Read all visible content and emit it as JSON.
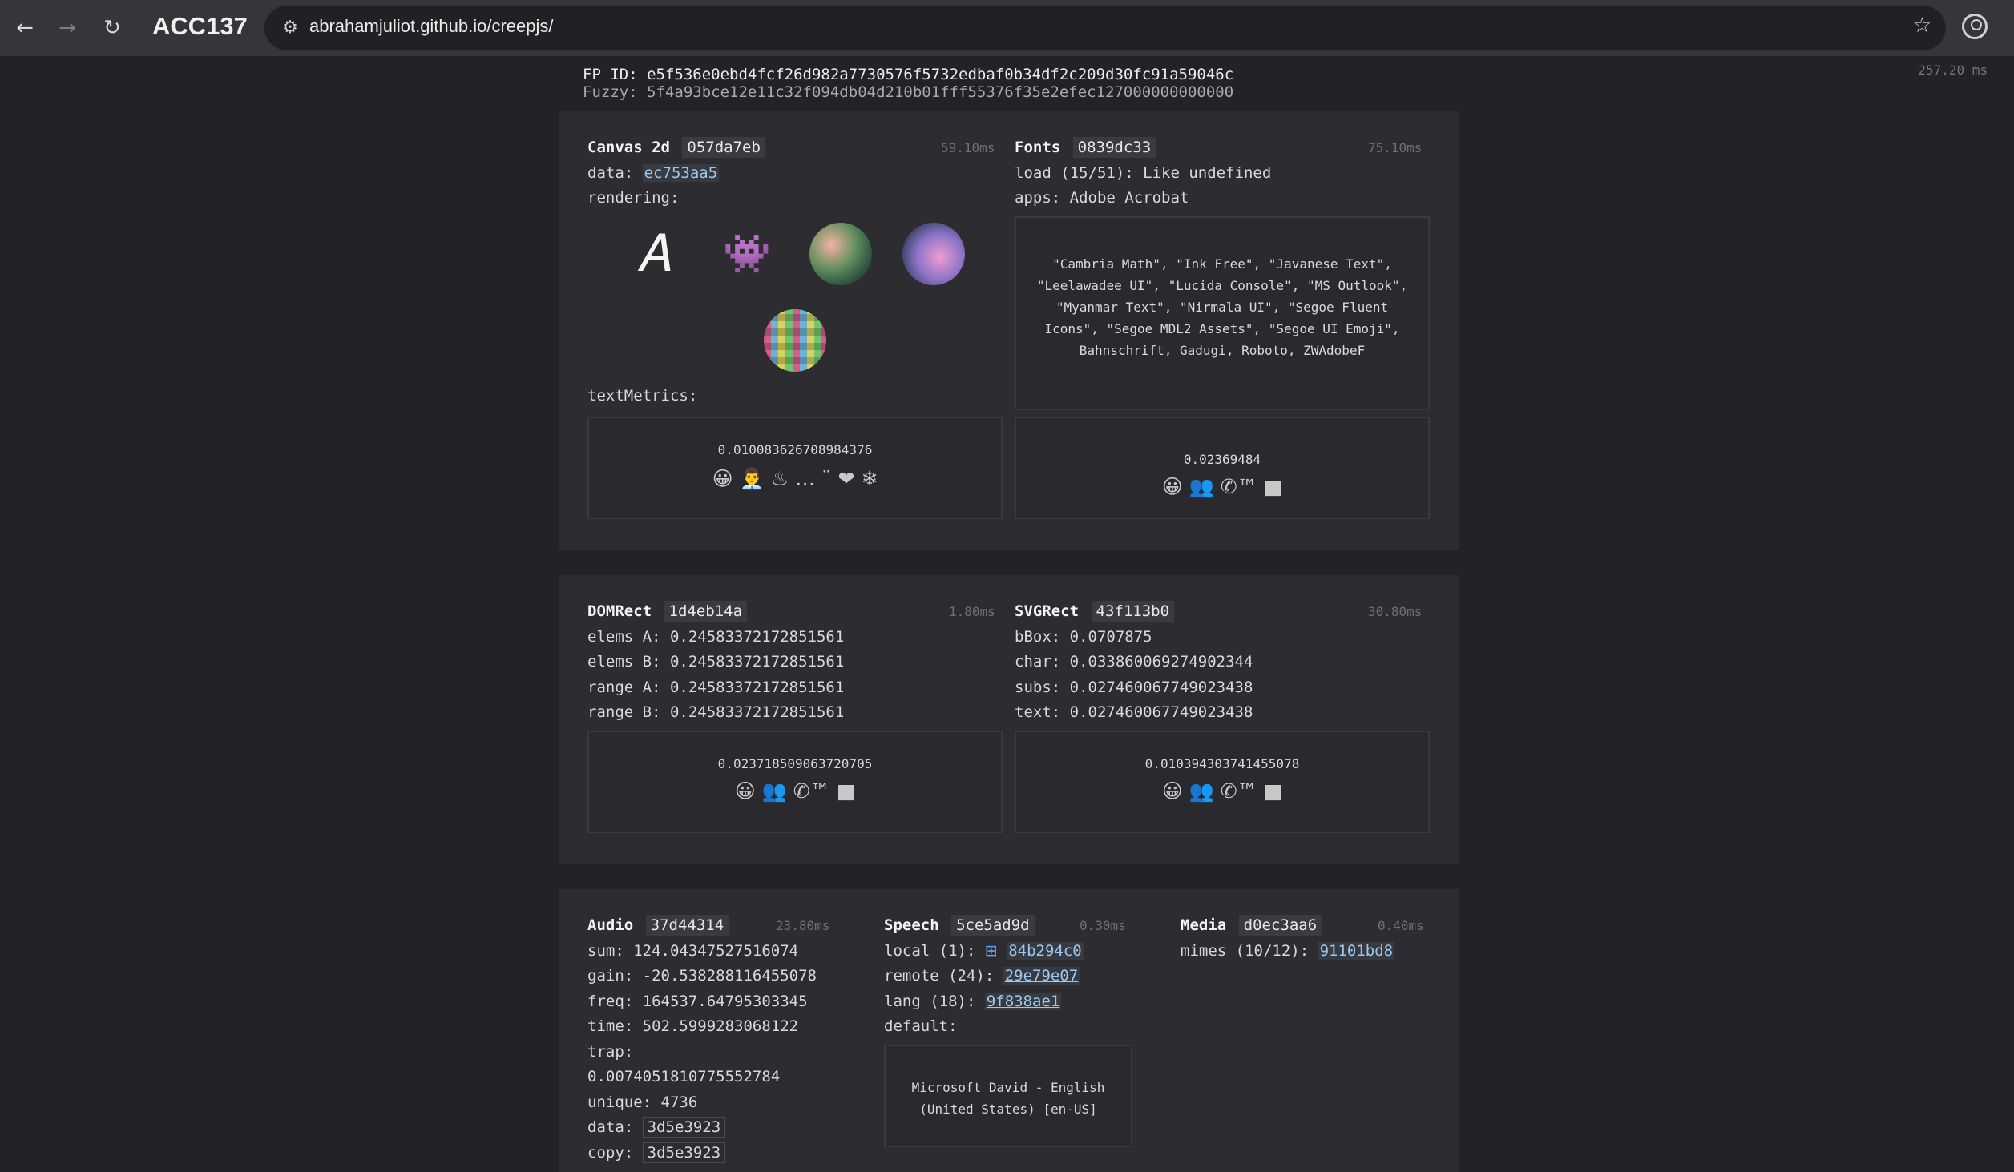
{
  "browser": {
    "tab_title": "ACC137",
    "url": "abrahamjuliot.github.io/creepjs/"
  },
  "header": {
    "fp_id_label": "FP ID:",
    "fp_id": "e5f536e0ebd4fcf26d982a7730576f5732edbaf0b34df2c209d30fc91a59046c",
    "fuzzy_label": "Fuzzy:",
    "fuzzy": "5f4a93bce12e11c32f094db04d210b01fff55376f35e2efec127000000000000",
    "total_time": "257.20 ms"
  },
  "canvas": {
    "title": "Canvas 2d",
    "hash": "057da7eb",
    "time": "59.10ms",
    "data_label": "data:",
    "data_hash": "ec753aa5",
    "rendering_label": "rendering:",
    "text_metrics_label": "textMetrics:",
    "metric_value": "0.010083626708984376",
    "metric_emojis": "😀 👨‍💼 ♨ … ¨ ❤ ❄"
  },
  "fonts": {
    "title": "Fonts",
    "hash": "0839dc33",
    "time": "75.10ms",
    "load": "load (15/51): Like undefined",
    "apps": "apps: Adobe Acrobat",
    "font_list": "\"Cambria Math\", \"Ink Free\", \"Javanese Text\", \"Leelawadee UI\", \"Lucida Console\", \"MS Outlook\", \"Myanmar Text\", \"Nirmala UI\", \"Segoe Fluent Icons\", \"Segoe MDL2 Assets\", \"Segoe UI Emoji\", Bahnschrift, Gadugi, Roboto, ZWAdobeF",
    "metric_value": "0.02369484",
    "metric_emojis": "😀 👥 ✆™ ■"
  },
  "domrect": {
    "title": "DOMRect",
    "hash": "1d4eb14a",
    "time": "1.80ms",
    "elems_a": "elems A: 0.24583372172851561",
    "elems_b": "elems B: 0.24583372172851561",
    "range_a": "range A: 0.24583372172851561",
    "range_b": "range B: 0.24583372172851561",
    "metric_value": "0.023718509063720705",
    "metric_emojis": "😀 👥 ✆™ ■"
  },
  "svgrect": {
    "title": "SVGRect",
    "hash": "43f113b0",
    "time": "30.80ms",
    "bbox": "bBox: 0.0707875",
    "char": "char: 0.033860069274902344",
    "subs": "subs: 0.027460067749023438",
    "text": "text: 0.027460067749023438",
    "metric_value": "0.010394303741455078",
    "metric_emojis": "😀 👥 ✆™ ■"
  },
  "audio": {
    "title": "Audio",
    "hash": "37d44314",
    "time": "23.80ms",
    "sum": "sum: 124.04347527516074",
    "gain": "gain: -20.538288116455078",
    "freq": "freq: 164537.64795303345",
    "time_value": "time: 502.5999283068122",
    "trap_label": "trap:",
    "trap_value": "0.0074051810775552784",
    "unique": "unique: 4736",
    "data_label": "data:",
    "data_hash": "3d5e3923",
    "copy_label": "copy:",
    "copy_hash": "3d5e3923"
  },
  "speech": {
    "title": "Speech",
    "hash": "5ce5ad9d",
    "time": "0.30ms",
    "local_label": "local (1):",
    "local_hash": "84b294c0",
    "remote_label": "remote (24):",
    "remote_hash": "29e79e07",
    "lang_label": "lang (18):",
    "lang_hash": "9f838ae1",
    "default_label": "default:",
    "default_voice": "Microsoft David - English (United States) [en-US]"
  },
  "media": {
    "title": "Media",
    "hash": "d0ec3aa6",
    "time": "0.40ms",
    "mimes_label": "mimes (10/12):",
    "mimes_hash": "91101bd8"
  }
}
